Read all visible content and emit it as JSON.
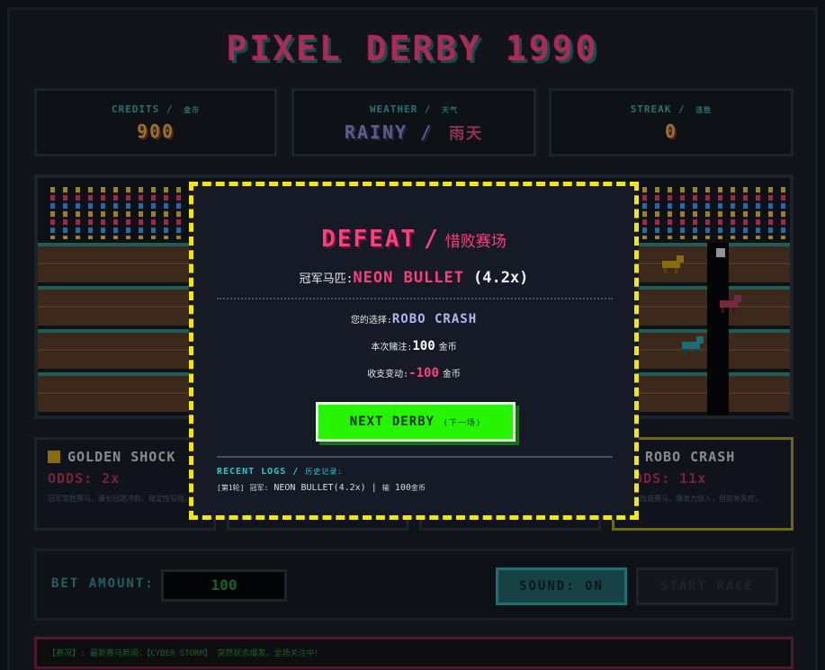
{
  "title": "PIXEL DERBY 1990",
  "stats": {
    "credits": {
      "label": "CREDITS",
      "label_cn": "金币",
      "value": "900"
    },
    "weather": {
      "label": "WEATHER",
      "label_cn": "天气",
      "value": "RAINY",
      "value_cn": "雨天"
    },
    "streak": {
      "label": "STREAK",
      "label_cn": "连胜",
      "value": "0"
    }
  },
  "horses": [
    {
      "name": "GOLDEN SHOCK",
      "odds": "ODDS: 2x",
      "desc": "冠军常胜赛马，擅长短距冲刺，稳定性较强。",
      "color": "#c9a20c"
    },
    {
      "name": "ROBO CRASH",
      "odds": "ODDS: 11x",
      "desc": "机械改造赛马，爆发力惊人，但容易失控。",
      "color": "#2a9fb0"
    }
  ],
  "bet": {
    "label": "BET AMOUNT:",
    "amount": "100",
    "sound_label": "SOUND: ON",
    "start_label": "START RACE"
  },
  "ticker": {
    "tag": "【赛况】:",
    "text": "最新赛马新闻：【CYBER STORM】 突然状态爆发，全场关注中！"
  },
  "modal": {
    "result_en": "DEFEAT",
    "slash": "/",
    "result_cn": "惜败赛场",
    "winner_label": "冠军马匹:",
    "winner_name": "NEON BULLET",
    "winner_mult": "(4.2x)",
    "choice_label": "您的选择:",
    "choice_value": "ROBO CRASH",
    "bet_label": "本次赌注:",
    "bet_value": "100",
    "unit": "金币",
    "change_label": "收支变动:",
    "change_value": "-100",
    "next_label": "NEXT DERBY",
    "next_cn": "(下一场)",
    "logs_label": "RECENT LOGS",
    "logs_cn": "历史记录:",
    "log_round": "[第1轮]",
    "log_winner_label": "冠军:",
    "log_winner": "NEON BULLET(4.2x)",
    "log_sep": "|",
    "log_bet_label": "输",
    "log_amount": "100",
    "log_unit": "金币"
  }
}
